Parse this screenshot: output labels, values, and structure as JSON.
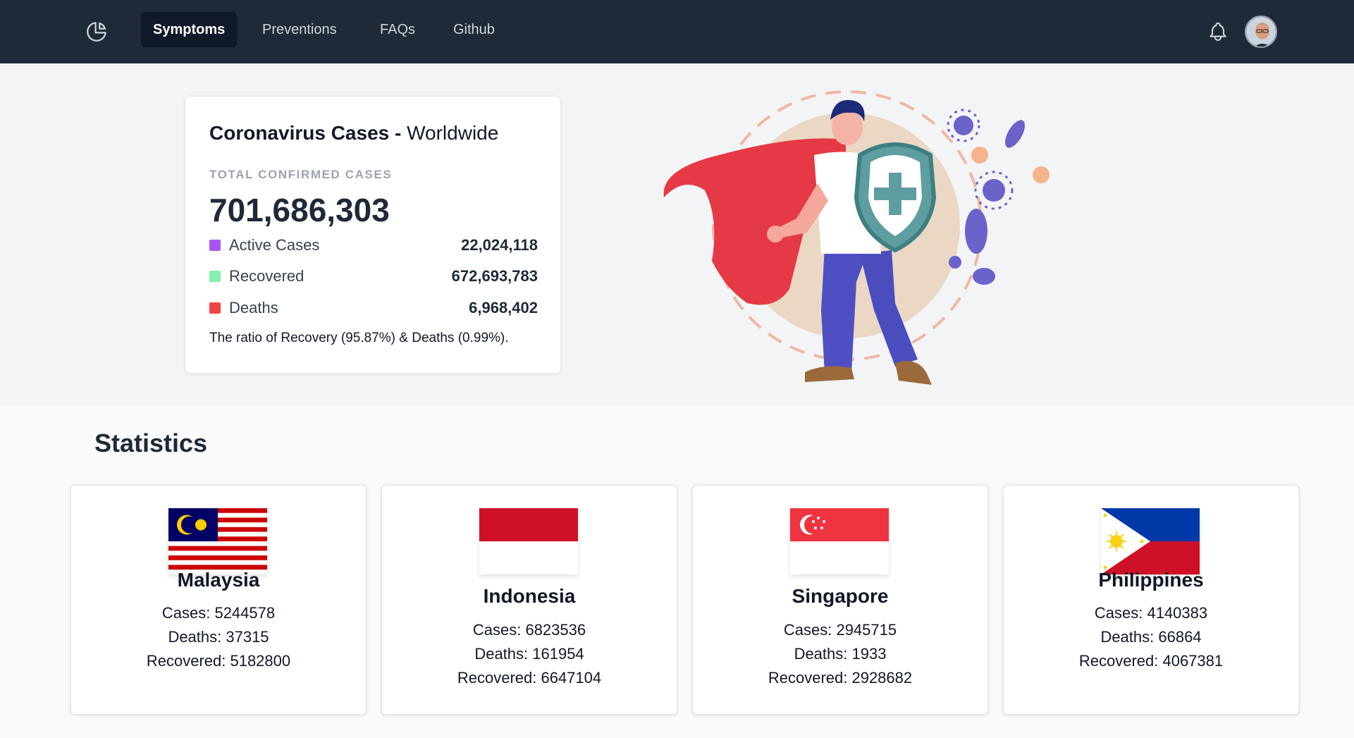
{
  "nav": {
    "logo_icon": "pie-chart-icon",
    "items": [
      {
        "label": "Symptoms",
        "active": true
      },
      {
        "label": "Preventions",
        "active": false
      },
      {
        "label": "FAQs",
        "active": false
      },
      {
        "label": "Github",
        "active": false
      }
    ],
    "notification_icon": "bell-icon",
    "avatar_icon": "user-avatar"
  },
  "summary": {
    "title": "Coronavirus Cases -",
    "subtitle": "Worldwide",
    "total_label": "TOTAL CONFIRMED CASES",
    "total_value": "701,686,303",
    "rows": [
      {
        "label": "Active Cases",
        "value": "22,024,118",
        "color": "#a855f7"
      },
      {
        "label": "Recovered",
        "value": "672,693,783",
        "color": "#86efac"
      },
      {
        "label": "Deaths",
        "value": "6,968,402",
        "color": "#ef4444"
      }
    ],
    "ratio_text": "The ratio of Recovery (95.87%) & Deaths (0.99%)."
  },
  "statistics": {
    "title": "Statistics",
    "countries": [
      {
        "name": "Malaysia",
        "cases": "Cases: 5244578",
        "deaths": "Deaths: 37315",
        "recovered": "Recovered: 5182800",
        "flag_icon": "malaysia-flag"
      },
      {
        "name": "Indonesia",
        "cases": "Cases: 6823536",
        "deaths": "Deaths: 161954",
        "recovered": "Recovered: 6647104",
        "flag_icon": "indonesia-flag"
      },
      {
        "name": "Singapore",
        "cases": "Cases: 2945715",
        "deaths": "Deaths: 1933",
        "recovered": "Recovered: 2928682",
        "flag_icon": "singapore-flag"
      },
      {
        "name": "Philippines",
        "cases": "Cases: 4140383",
        "deaths": "Deaths: 66864",
        "recovered": "Recovered: 4067381",
        "flag_icon": "philippines-flag"
      }
    ]
  },
  "colors": {
    "nav_bg": "#1f2937",
    "hero_bg": "#f3f4f6",
    "shield": "#5f9ea0",
    "cape": "#e53945",
    "virus": "#6b63c9"
  }
}
